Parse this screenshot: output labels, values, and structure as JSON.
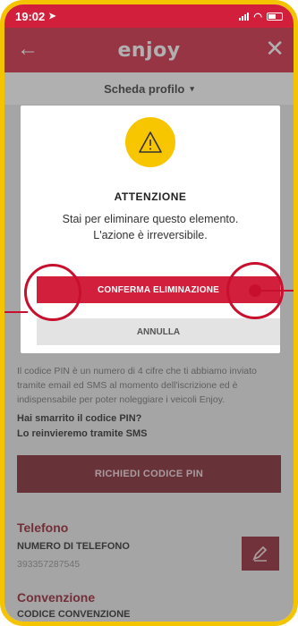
{
  "status": {
    "time": "19:02"
  },
  "header": {
    "logo": "enjoy",
    "back": "←",
    "close": "✕"
  },
  "subheader": {
    "title": "Scheda profilo",
    "caret": "▾"
  },
  "background": {
    "pin_info": "Il codice PIN è un numero di 4 cifre che ti abbiamo inviato tramite email ed SMS al momento dell'iscrizione ed è indispensabile per poter noleggiare i veicoli Enjoy.",
    "pin_lost": "Hai smarrito il codice PIN?",
    "pin_resend": "Lo reinvieremo tramite SMS",
    "pin_button": "RICHIEDI CODICE PIN",
    "phone_section": "Telefono",
    "phone_label": "NUMERO DI TELEFONO",
    "phone_value": "393357287545",
    "agreement_section": "Convenzione",
    "agreement_label": "CODICE CONVENZIONE"
  },
  "modal": {
    "icon": "warning-icon",
    "title": "ATTENZIONE",
    "line1": "Stai per eliminare questo elemento.",
    "line2": "L'azione è irreversibile.",
    "confirm": "CONFERMA ELIMINAZIONE",
    "cancel": "ANNULLA"
  },
  "colors": {
    "brand_red": "#d21f3c",
    "warning_yellow": "#f7c600",
    "frame": "#f5c400"
  }
}
